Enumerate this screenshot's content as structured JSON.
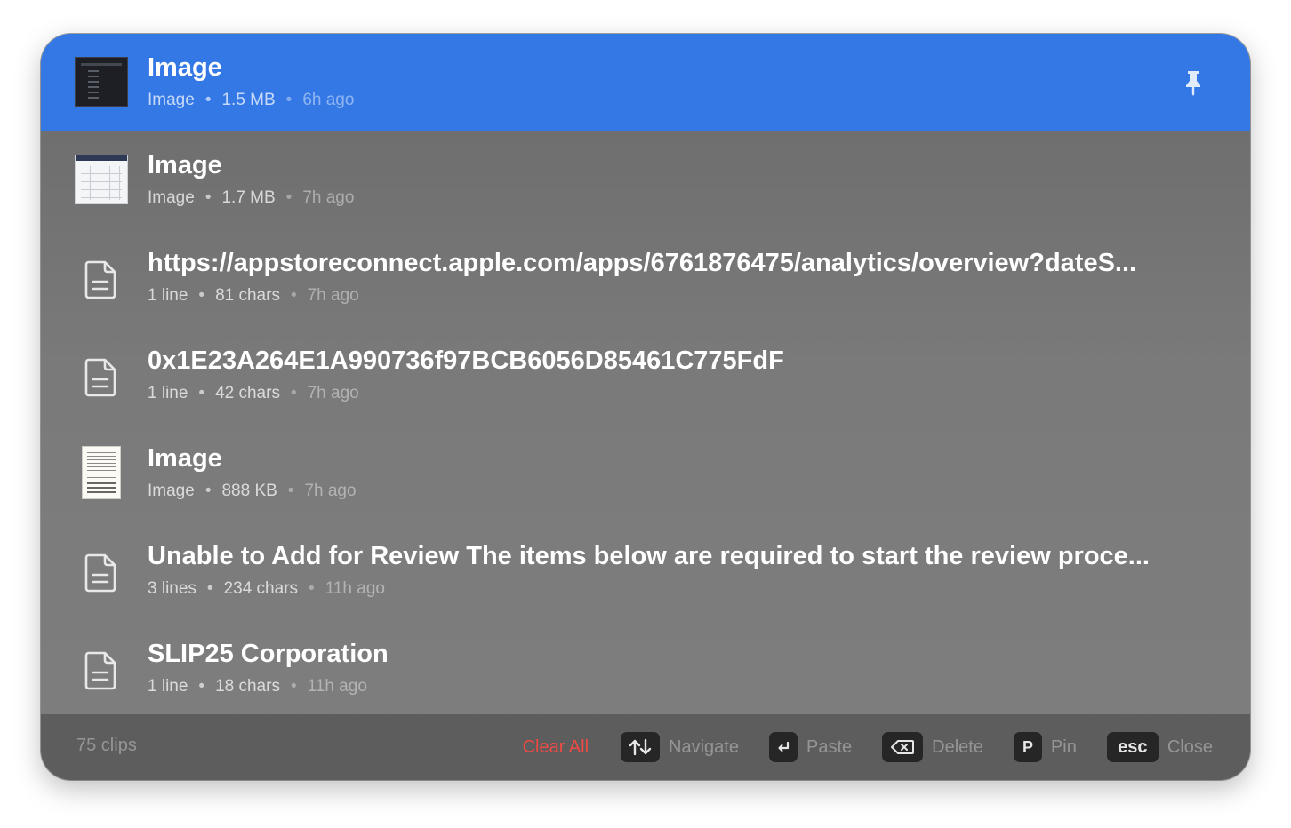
{
  "items": [
    {
      "title": "Image",
      "type": "image",
      "thumb": "dark-screenshot",
      "meta1": "Image",
      "meta2": "1.5 MB",
      "time": "6h ago",
      "selected": true
    },
    {
      "title": "Image",
      "type": "image",
      "thumb": "light-screenshot",
      "meta1": "Image",
      "meta2": "1.7 MB",
      "time": "7h ago",
      "selected": false
    },
    {
      "title": "https://appstoreconnect.apple.com/apps/6761876475/analytics/overview?dateS...",
      "type": "text",
      "meta1": "1 line",
      "meta2": "81 chars",
      "time": "7h ago",
      "selected": false
    },
    {
      "title": "0x1E23A264E1A990736f97BCB6056D85461C775FdF",
      "type": "text",
      "meta1": "1 line",
      "meta2": "42 chars",
      "time": "7h ago",
      "selected": false
    },
    {
      "title": "Image",
      "type": "image",
      "thumb": "document-scan",
      "meta1": "Image",
      "meta2": "888 KB",
      "time": "7h ago",
      "selected": false
    },
    {
      "title": "Unable to Add for Review  The items below are required to start the review proce...",
      "type": "text",
      "meta1": "3 lines",
      "meta2": "234 chars",
      "time": "11h ago",
      "selected": false
    },
    {
      "title": "SLIP25 Corporation",
      "type": "text",
      "meta1": "1 line",
      "meta2": "18 chars",
      "time": "11h ago",
      "selected": false
    }
  ],
  "separator": "•",
  "pin_icon": "pin-icon",
  "footer": {
    "count": "75 clips",
    "clear_all": "Clear All",
    "navigate_label": "Navigate",
    "paste_label": "Paste",
    "delete_label": "Delete",
    "pin_key": "P",
    "pin_label": "Pin",
    "esc_key": "esc",
    "close_label": "Close"
  },
  "colors": {
    "selection": "#3478e6",
    "clear_all": "#ef4a44",
    "key_bg": "#262626"
  }
}
